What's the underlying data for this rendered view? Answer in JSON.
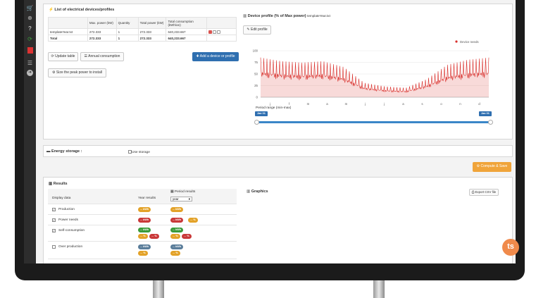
{
  "sidebar": {
    "icons": [
      "cart-icon",
      "globe-icon",
      "help-icon",
      "refresh-icon",
      "pdf-icon",
      "list-icon",
      "arrow-right-icon"
    ]
  },
  "devices": {
    "title": "List of electrical devices/profiles",
    "columns": [
      "Max. power (kW)",
      "Quantity",
      "Total power (kW)",
      "Total consumption (kWh/an)"
    ],
    "rows": [
      {
        "name": "templateYear.txt",
        "max_power": "272.333",
        "quantity": "1",
        "total_power": "272.333",
        "consumption": "640,233.667"
      }
    ],
    "total": {
      "label": "Total",
      "max_power": "272.333",
      "quantity": "1",
      "total_power": "272.333",
      "consumption": "640,233.667"
    },
    "buttons": {
      "update": "Update table",
      "annual": "Annual consumption",
      "add": "Add a device or profile",
      "size": "Size the peak power to install"
    }
  },
  "profile": {
    "title": "Device profile (% of Max power)",
    "file": "templateYear.txt",
    "edit": "Edit profile",
    "legend": "Device needs",
    "period_label": "Period range (min-max)",
    "period_start": "Jan 01",
    "period_end": "Jan 01"
  },
  "chart_data": {
    "type": "line",
    "title": "",
    "series": [
      {
        "name": "Device needs",
        "color": "#d9302c"
      }
    ],
    "y_ticks": [
      "100",
      "75",
      "50",
      "25",
      "0"
    ],
    "ylim": [
      0,
      100
    ],
    "x_ticks": [
      "j",
      "f",
      "m",
      "a",
      "m",
      "j",
      "j",
      "a",
      "s",
      "o",
      "n",
      "d"
    ],
    "x": [
      "j",
      "f",
      "m",
      "a",
      "m",
      "j",
      "j",
      "a",
      "s",
      "o",
      "n",
      "d"
    ],
    "values": [
      55,
      50,
      48,
      50,
      42,
      20,
      15,
      13,
      25,
      45,
      52,
      55
    ]
  },
  "storage": {
    "title": "Energy storage :",
    "option": "Use storage"
  },
  "compute": {
    "label": "Compute & Save"
  },
  "results": {
    "title": "Results",
    "header_display": "Display data",
    "header_year": "Year results",
    "header_period": "Period results",
    "period_select": "year",
    "rows": [
      {
        "label": "Production",
        "checked": "✓",
        "year": [
          "... kWh"
        ],
        "period": [
          "... kWh"
        ]
      },
      {
        "label": "Power needs",
        "checked": "✓",
        "year": [
          "... kWh"
        ],
        "period": [
          "... kWh",
          "... %"
        ]
      },
      {
        "label": "Self-consumption",
        "checked": "✓",
        "year": [
          "... kWh",
          "... %",
          "... %"
        ],
        "period": [
          "... kWh",
          "... %",
          "... %"
        ]
      },
      {
        "label": "Over production",
        "checked": "",
        "year": [
          "... kWh",
          "... %"
        ],
        "period": [
          "... kWh",
          "... %"
        ]
      }
    ]
  },
  "graphics": {
    "title": "Graphics",
    "export": "Export CSV file"
  },
  "avatar_text": "ts"
}
